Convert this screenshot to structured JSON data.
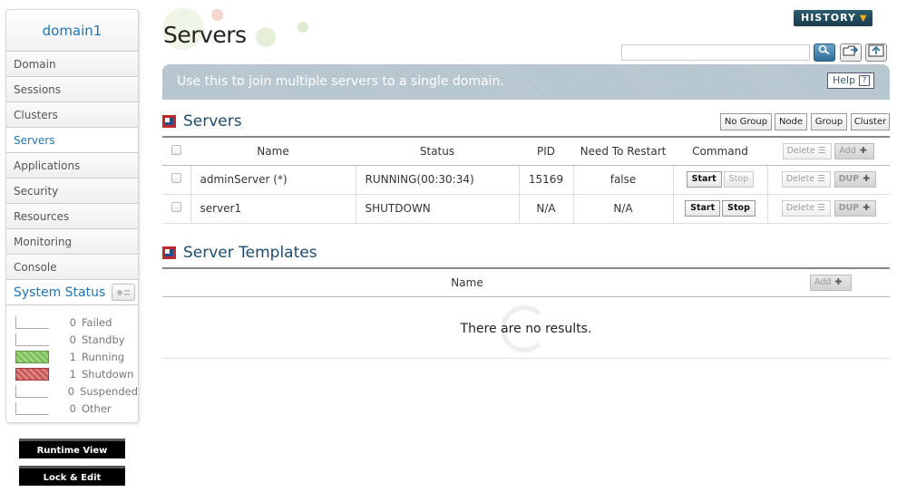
{
  "sidebar": {
    "domain": "domain1",
    "items": [
      {
        "label": "Domain"
      },
      {
        "label": "Sessions"
      },
      {
        "label": "Clusters"
      },
      {
        "label": "Servers"
      },
      {
        "label": "Applications"
      },
      {
        "label": "Security"
      },
      {
        "label": "Resources"
      },
      {
        "label": "Monitoring"
      },
      {
        "label": "Console"
      }
    ],
    "active_item": "Servers",
    "system_status": {
      "title": "System Status",
      "rows": [
        {
          "count": "0",
          "label": "Failed"
        },
        {
          "count": "0",
          "label": "Standby"
        },
        {
          "count": "1",
          "label": "Running"
        },
        {
          "count": "1",
          "label": "Shutdown"
        },
        {
          "count": "0",
          "label": "Suspended"
        },
        {
          "count": "0",
          "label": "Other"
        }
      ]
    },
    "runtime_view": "Runtime View",
    "lock_edit": "Lock & Edit"
  },
  "header": {
    "title": "Servers",
    "history": "HISTORY",
    "search_value": ""
  },
  "banner": {
    "text": "Use this to join multiple servers to a single domain.",
    "help": "Help",
    "help_icon": "?"
  },
  "servers": {
    "title": "Servers",
    "group_buttons": [
      "No Group",
      "Node",
      "Group",
      "Cluster"
    ],
    "columns": {
      "name": "Name",
      "status": "Status",
      "pid": "PID",
      "restart": "Need To Restart",
      "command": "Command"
    },
    "delete_label": "Delete",
    "add_label": "Add",
    "start_label": "Start",
    "stop_label": "Stop",
    "dup_label": "DUP",
    "rows": [
      {
        "name": "adminServer (*)",
        "status": "RUNNING(00:30:34)",
        "pid": "15169",
        "restart": "false"
      },
      {
        "name": "server1",
        "status": "SHUTDOWN",
        "pid": "N/A",
        "restart": "N/A"
      }
    ]
  },
  "templates": {
    "title": "Server Templates",
    "column_name": "Name",
    "add_label": "Add",
    "empty": "There are no results."
  },
  "colors": {
    "accent": "#1f74b5",
    "running": "#7cbf5a",
    "shutdown": "#c95a5a"
  }
}
